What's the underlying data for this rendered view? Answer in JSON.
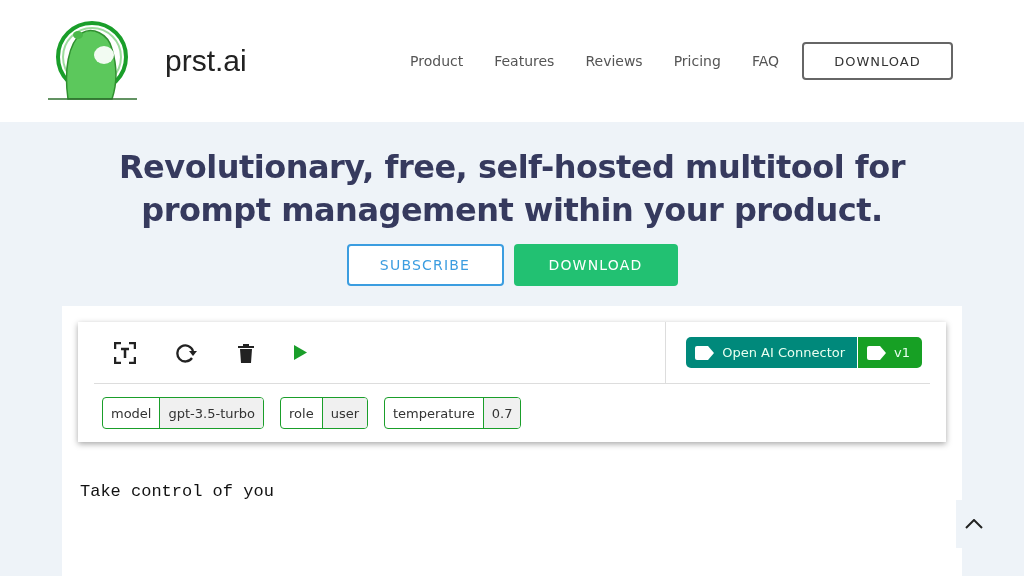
{
  "header": {
    "brand": "prst.ai",
    "nav": [
      {
        "label": "Product"
      },
      {
        "label": "Features"
      },
      {
        "label": "Reviews"
      },
      {
        "label": "Pricing"
      },
      {
        "label": "FAQ"
      }
    ],
    "download": "DOWNLOAD"
  },
  "hero": {
    "headline": "Revolutionary, free, self-hosted multitool for prompt management within your product.",
    "buttons": [
      {
        "label": "SUBSCRIBE",
        "kind": "outline"
      },
      {
        "label": "DOWNLOAD",
        "kind": "filled"
      }
    ]
  },
  "editor": {
    "connectors": [
      {
        "label": "Open AI Connector",
        "color": "#00897b"
      },
      {
        "label": "v1",
        "color": "#17a024"
      }
    ],
    "params": [
      {
        "key": "model",
        "value": "gpt-3.5-turbo"
      },
      {
        "key": "role",
        "value": "user"
      },
      {
        "key": "temperature",
        "value": "0.7"
      }
    ],
    "prompt_text": "Take control of you"
  }
}
